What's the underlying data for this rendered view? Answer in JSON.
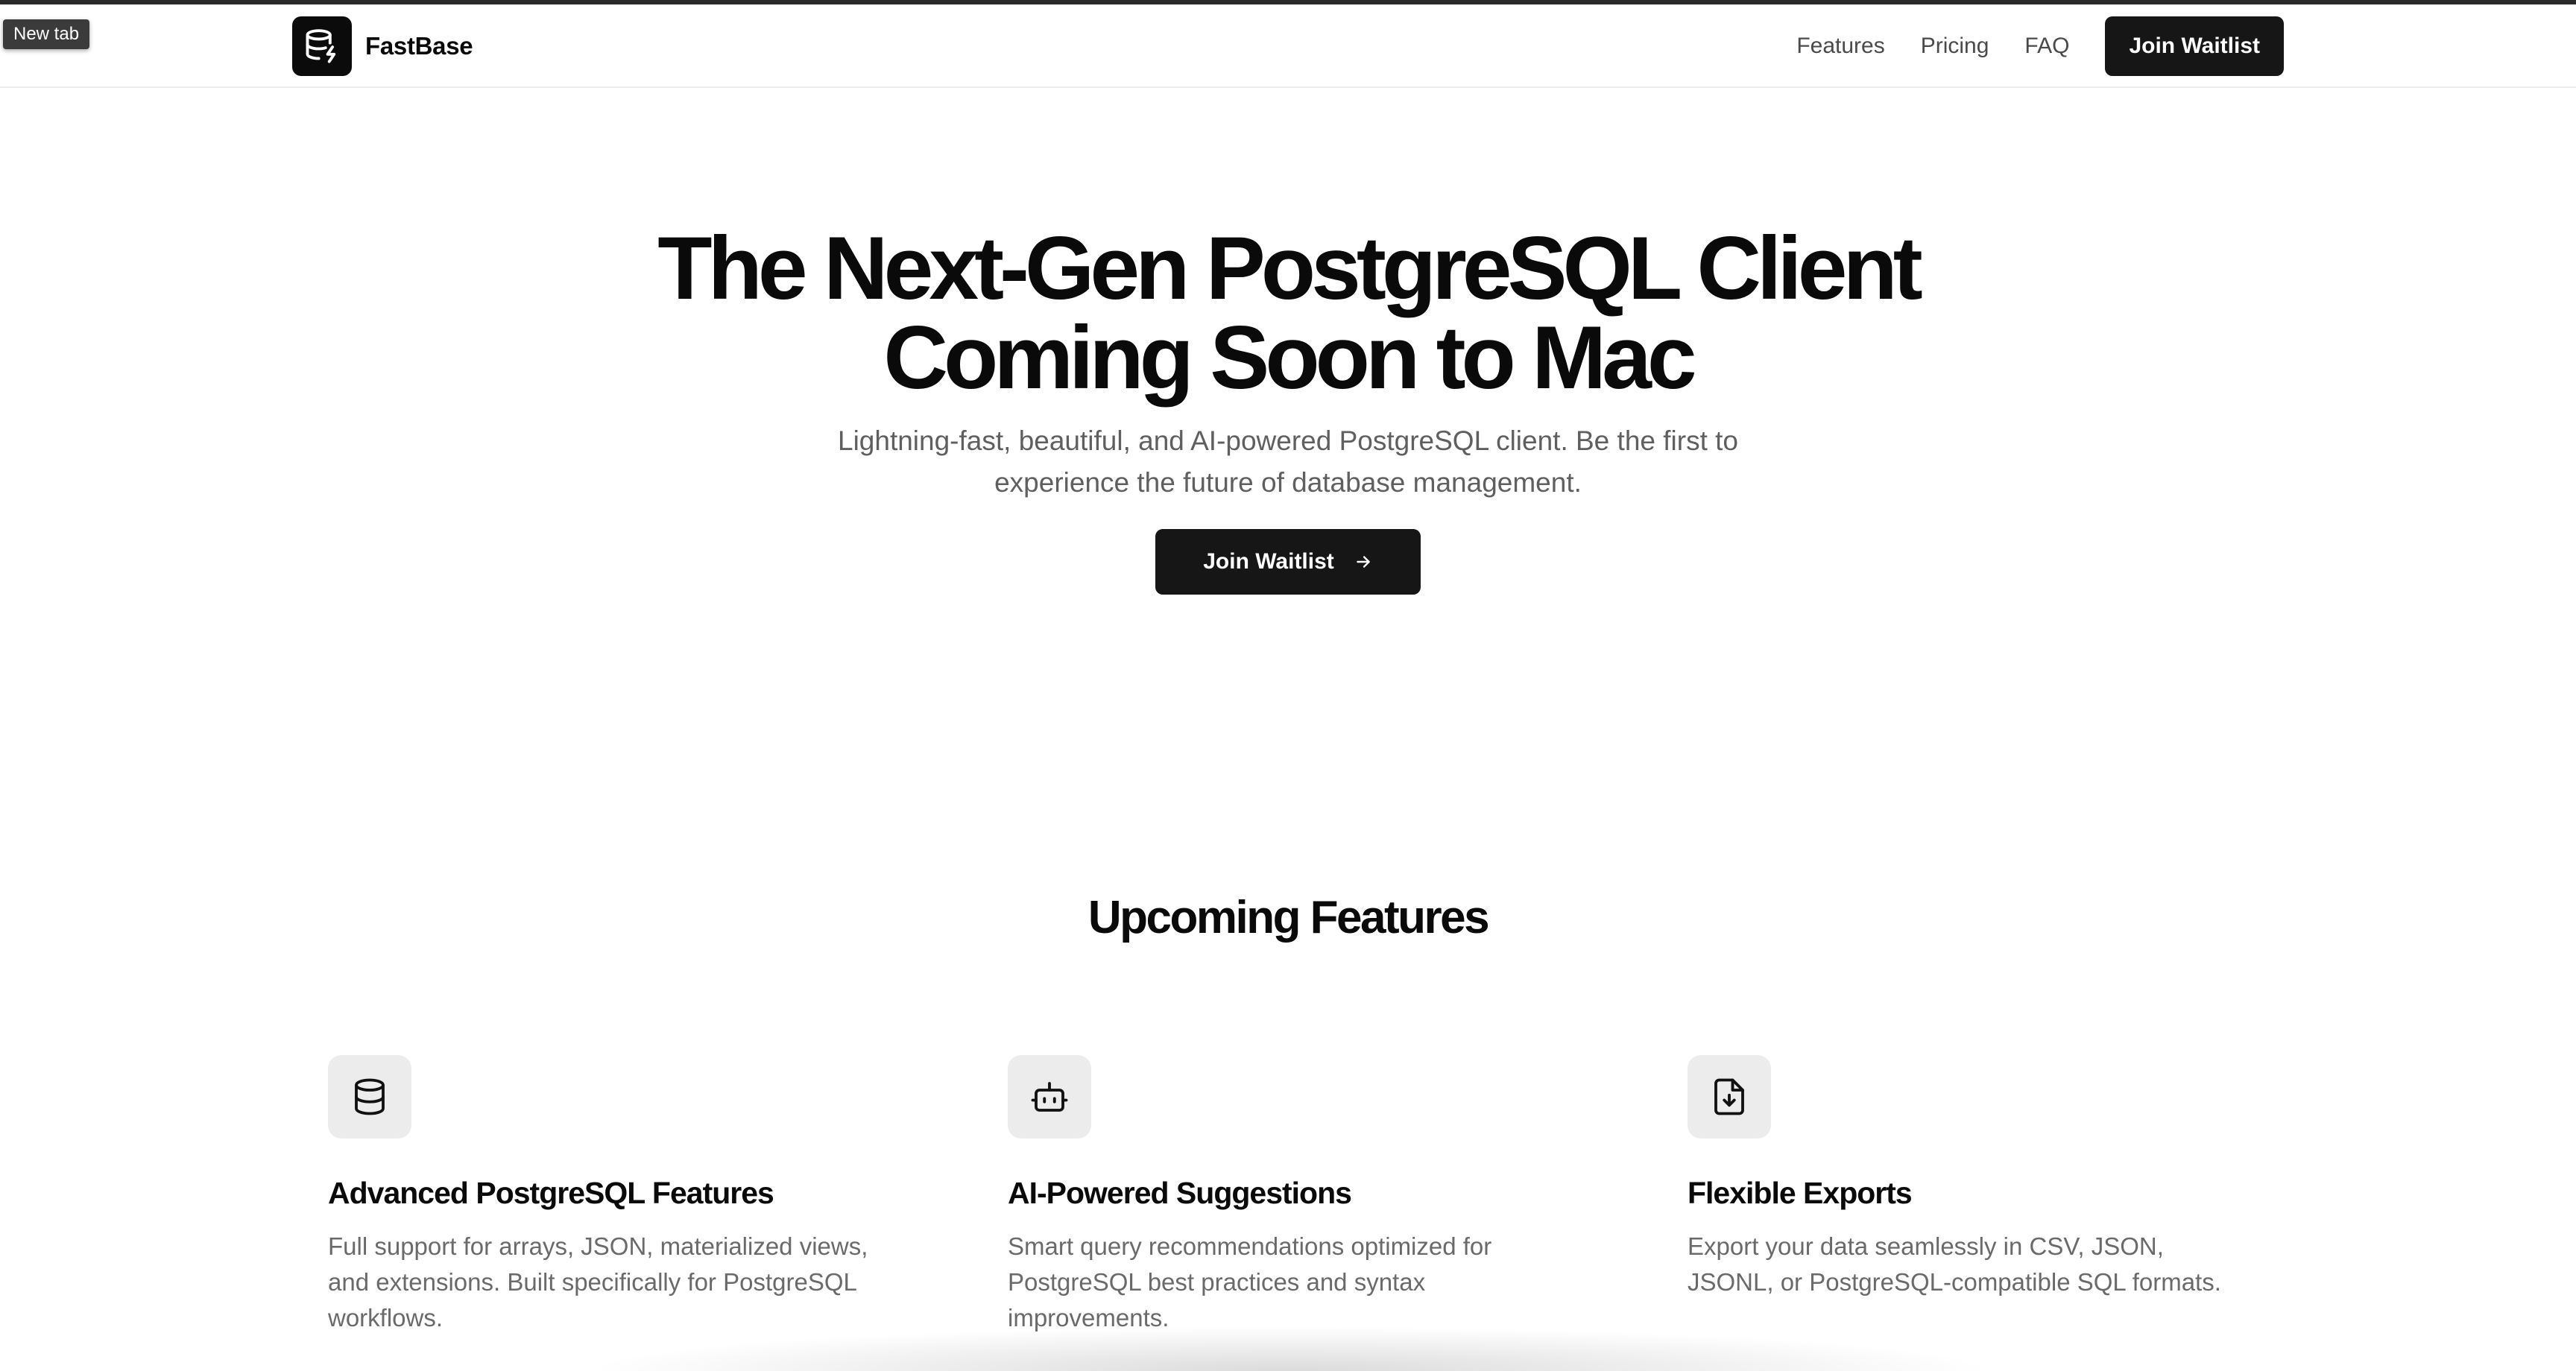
{
  "tooltip": {
    "text": "New tab"
  },
  "brand": {
    "name": "FastBase",
    "logo_icon": "database-bolt-icon"
  },
  "nav": {
    "links": [
      {
        "label": "Features"
      },
      {
        "label": "Pricing"
      },
      {
        "label": "FAQ"
      }
    ],
    "cta": "Join Waitlist"
  },
  "hero": {
    "title_line1": "The Next-Gen PostgreSQL Client",
    "title_line2": "Coming Soon to Mac",
    "subtitle": "Lightning-fast, beautiful, and AI-powered PostgreSQL client. Be the first to experience the future of database management.",
    "cta": "Join Waitlist",
    "cta_icon": "arrow-right-icon"
  },
  "features": {
    "heading": "Upcoming Features",
    "items": [
      {
        "icon": "database-icon",
        "title": "Advanced PostgreSQL Features",
        "description": "Full support for arrays, JSON, materialized views, and extensions. Built specifically for PostgreSQL workflows."
      },
      {
        "icon": "bot-icon",
        "title": "AI-Powered Suggestions",
        "description": "Smart query recommendations optimized for PostgreSQL best practices and syntax improvements."
      },
      {
        "icon": "file-download-icon",
        "title": "Flexible Exports",
        "description": "Export your data seamlessly in CSV, JSON, JSONL, or PostgreSQL-compatible SQL formats."
      }
    ]
  },
  "colors": {
    "text": "#0a0a0a",
    "muted": "#5f5f5f",
    "button": "#161616",
    "icon_box": "#ececec"
  }
}
